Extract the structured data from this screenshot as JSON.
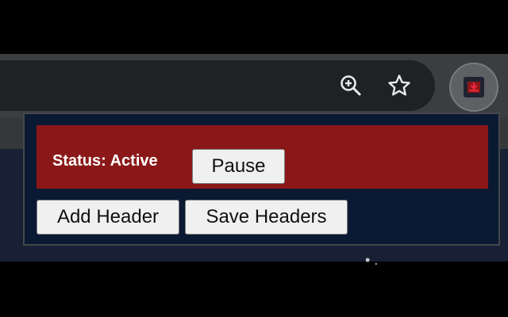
{
  "browser": {
    "zoom_icon": "zoom-in-icon",
    "bookmark_icon": "star-icon",
    "extension_icon": "download-icon",
    "page_text_fragment": "• ."
  },
  "popup": {
    "status_label": "Status: Active",
    "pause_label": "Pause",
    "add_header_label": "Add Header",
    "save_headers_label": "Save Headers"
  },
  "colors": {
    "status_bar": "#8b1818",
    "popup_background": "#0b1a33",
    "extension_icon_accent": "#e8283f"
  }
}
